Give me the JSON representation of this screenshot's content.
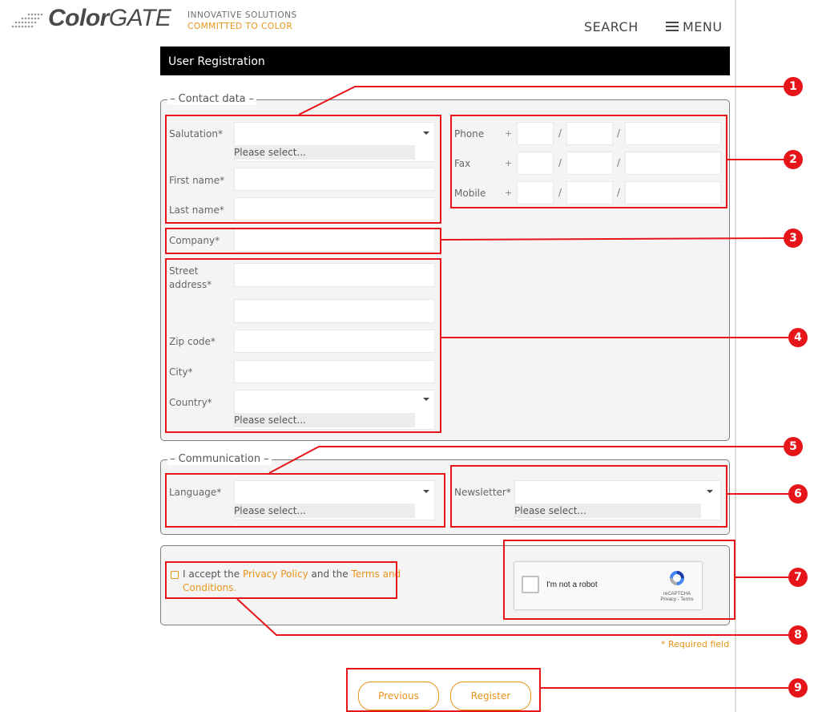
{
  "header": {
    "logo_bold": "Color",
    "logo_regular": "GATE",
    "tagline_1": "INNOVATIVE SOLUTIONS",
    "tagline_2": "COMMITTED TO COLOR",
    "search_label": "SEARCH",
    "menu_label": "MENU"
  },
  "page_title": "User Registration",
  "contact": {
    "legend": "Contact data",
    "salutation_label": "Salutation*",
    "salutation_placeholder": "Please select...",
    "first_name_label": "First name*",
    "last_name_label": "Last name*",
    "company_label": "Company*",
    "street_label": "Street address*",
    "zip_label": "Zip code*",
    "city_label": "City*",
    "country_label": "Country*",
    "country_placeholder": "Please select...",
    "phone_label": "Phone",
    "fax_label": "Fax",
    "mobile_label": "Mobile",
    "plus": "+",
    "slash": "/"
  },
  "communication": {
    "legend": "Communication",
    "language_label": "Language*",
    "language_placeholder": "Please select...",
    "newsletter_label": "Newsletter*",
    "newsletter_placeholder": "Please select..."
  },
  "consent": {
    "text_1": "I accept the ",
    "privacy_link": "Privacy Policy",
    "text_2": " and the ",
    "terms_link": "Terms and Conditions."
  },
  "captcha": {
    "label": "I'm not a robot",
    "brand": "reCAPTCHA",
    "links": "Privacy - Terms"
  },
  "required_note": "* Required field",
  "buttons": {
    "previous": "Previous",
    "register": "Register"
  },
  "annotations": [
    "1",
    "2",
    "3",
    "4",
    "5",
    "6",
    "7",
    "8",
    "9"
  ],
  "colors": {
    "accent": "#e8931a",
    "annotation": "#e5151a",
    "title_bar": "#000000"
  }
}
